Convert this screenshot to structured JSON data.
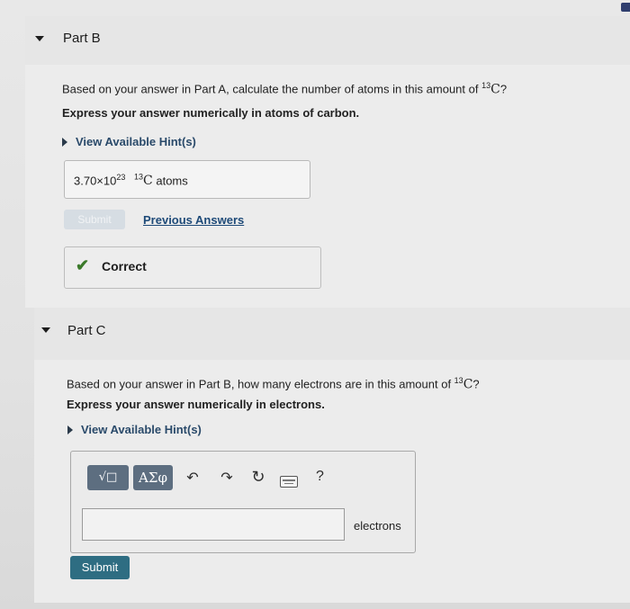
{
  "part_b": {
    "title": "Part B",
    "question_prefix": "Based on your answer in Part A, calculate the number of atoms in this amount of ",
    "isotope_mass": "13",
    "isotope_symbol": "C",
    "question_suffix": "?",
    "instruction": "Express your answer numerically in atoms of carbon.",
    "hint_label": "View Available Hint(s)",
    "answer": {
      "mantissa": "3.70×10",
      "exponent": "23",
      "isotope_mass": "13",
      "isotope_symbol": "C",
      "unit": "atoms"
    },
    "submit_label": "Submit",
    "previous_answers_label": "Previous Answers",
    "feedback": "Correct"
  },
  "part_c": {
    "title": "Part C",
    "question_prefix": "Based on your answer in Part B, how many electrons are in this amount of ",
    "isotope_mass": "13",
    "isotope_symbol": "C",
    "question_suffix": "?",
    "instruction": "Express your answer numerically in electrons.",
    "hint_label": "View Available Hint(s)",
    "toolbar": {
      "templates_label": "√□",
      "symbols_label": "ΑΣφ",
      "undo_icon": "undo-icon",
      "redo_icon": "redo-icon",
      "reset_icon": "reset-icon",
      "keyboard_icon": "keyboard-icon",
      "help_label": "?"
    },
    "input_value": "",
    "unit_label": "electrons",
    "submit_label": "Submit"
  },
  "colors": {
    "link": "#1e4a78",
    "correct_check": "#3b7a2a",
    "submit_button": "#2e6d82",
    "toolbar_button": "#5d6e80"
  }
}
